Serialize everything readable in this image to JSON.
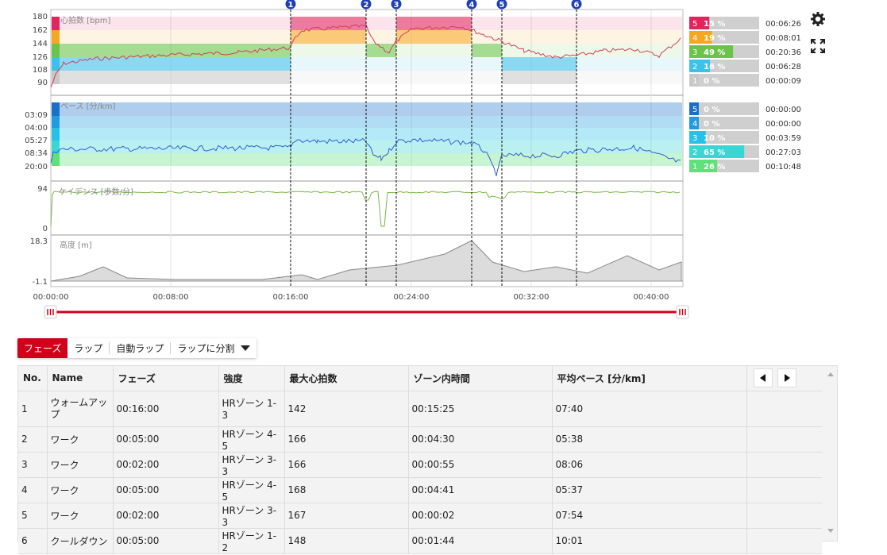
{
  "charts": {
    "hr": {
      "label": "心拍数 [bpm]",
      "y_ticks": [
        "180",
        "162",
        "144",
        "126",
        "108",
        "90"
      ],
      "zones": [
        {
          "zone": "5",
          "percent": "15 %",
          "time": "00:06:26",
          "color": "#e0245e"
        },
        {
          "zone": "4",
          "percent": "19 %",
          "time": "00:08:01",
          "color": "#f5a623"
        },
        {
          "zone": "3",
          "percent": "49 %",
          "time": "00:20:36",
          "color": "#6cc24a"
        },
        {
          "zone": "2",
          "percent": "16 %",
          "time": "00:06:28",
          "color": "#3ec1e8"
        },
        {
          "zone": "1",
          "percent": "0 %",
          "time": "00:00:09",
          "color": "#c8c8c8"
        }
      ]
    },
    "pace": {
      "label": "ペース [分/km]",
      "y_ticks": [
        "03:09",
        "04:00",
        "05:27",
        "08:34",
        "20:00"
      ],
      "zones": [
        {
          "zone": "5",
          "percent": "0 %",
          "time": "00:00:00",
          "color": "#1a6fc9"
        },
        {
          "zone": "4",
          "percent": "0 %",
          "time": "00:00:00",
          "color": "#1f9be0"
        },
        {
          "zone": "3",
          "percent": "10 %",
          "time": "00:03:59",
          "color": "#27c0e8"
        },
        {
          "zone": "2",
          "percent": "65 %",
          "time": "00:27:03",
          "color": "#3ad6d4"
        },
        {
          "zone": "1",
          "percent": "26 %",
          "time": "00:10:48",
          "color": "#5ee07a"
        }
      ]
    },
    "cadence": {
      "label": "ケイデンス [歩数/分]",
      "y_ticks": [
        "94",
        "0"
      ]
    },
    "altitude": {
      "label": "高度 [m]",
      "y_ticks": [
        "18.3",
        "-1.1"
      ]
    },
    "markers": [
      "1",
      "2",
      "3",
      "4",
      "5",
      "6"
    ],
    "x_ticks": [
      "00:00:00",
      "00:08:00",
      "00:16:00",
      "00:24:00",
      "00:32:00",
      "00:40:00"
    ]
  },
  "tabs": [
    "フェーズ",
    "ラップ",
    "自動ラップ",
    "ラップに分割"
  ],
  "table": {
    "headers": [
      "No.",
      "Name",
      "フェーズ",
      "強度",
      "最大心拍数",
      "ゾーン内時間",
      "平均ペース [分/km]"
    ],
    "rows": [
      [
        "1",
        "ウォームアップ",
        "00:16:00",
        "HRゾーン 1-3",
        "142",
        "00:15:25",
        "07:40"
      ],
      [
        "2",
        "ワーク",
        "00:05:00",
        "HRゾーン 4-5",
        "166",
        "00:04:30",
        "05:38"
      ],
      [
        "3",
        "ワーク",
        "00:02:00",
        "HRゾーン 3-3",
        "166",
        "00:00:55",
        "08:06"
      ],
      [
        "4",
        "ワーク",
        "00:05:00",
        "HRゾーン 4-5",
        "168",
        "00:04:41",
        "05:37"
      ],
      [
        "5",
        "ワーク",
        "00:02:00",
        "HRゾーン 3-3",
        "167",
        "00:00:02",
        "07:54"
      ],
      [
        "6",
        "クールダウン",
        "00:05:00",
        "HRゾーン 1-2",
        "148",
        "00:01:44",
        "10:01"
      ]
    ]
  },
  "colors": {
    "accent": "#d0021b",
    "marker": "#1d3fb8",
    "hr_line": "#d0405a",
    "pace_line": "#2e5fd6",
    "cadence_line": "#7ab648"
  }
}
